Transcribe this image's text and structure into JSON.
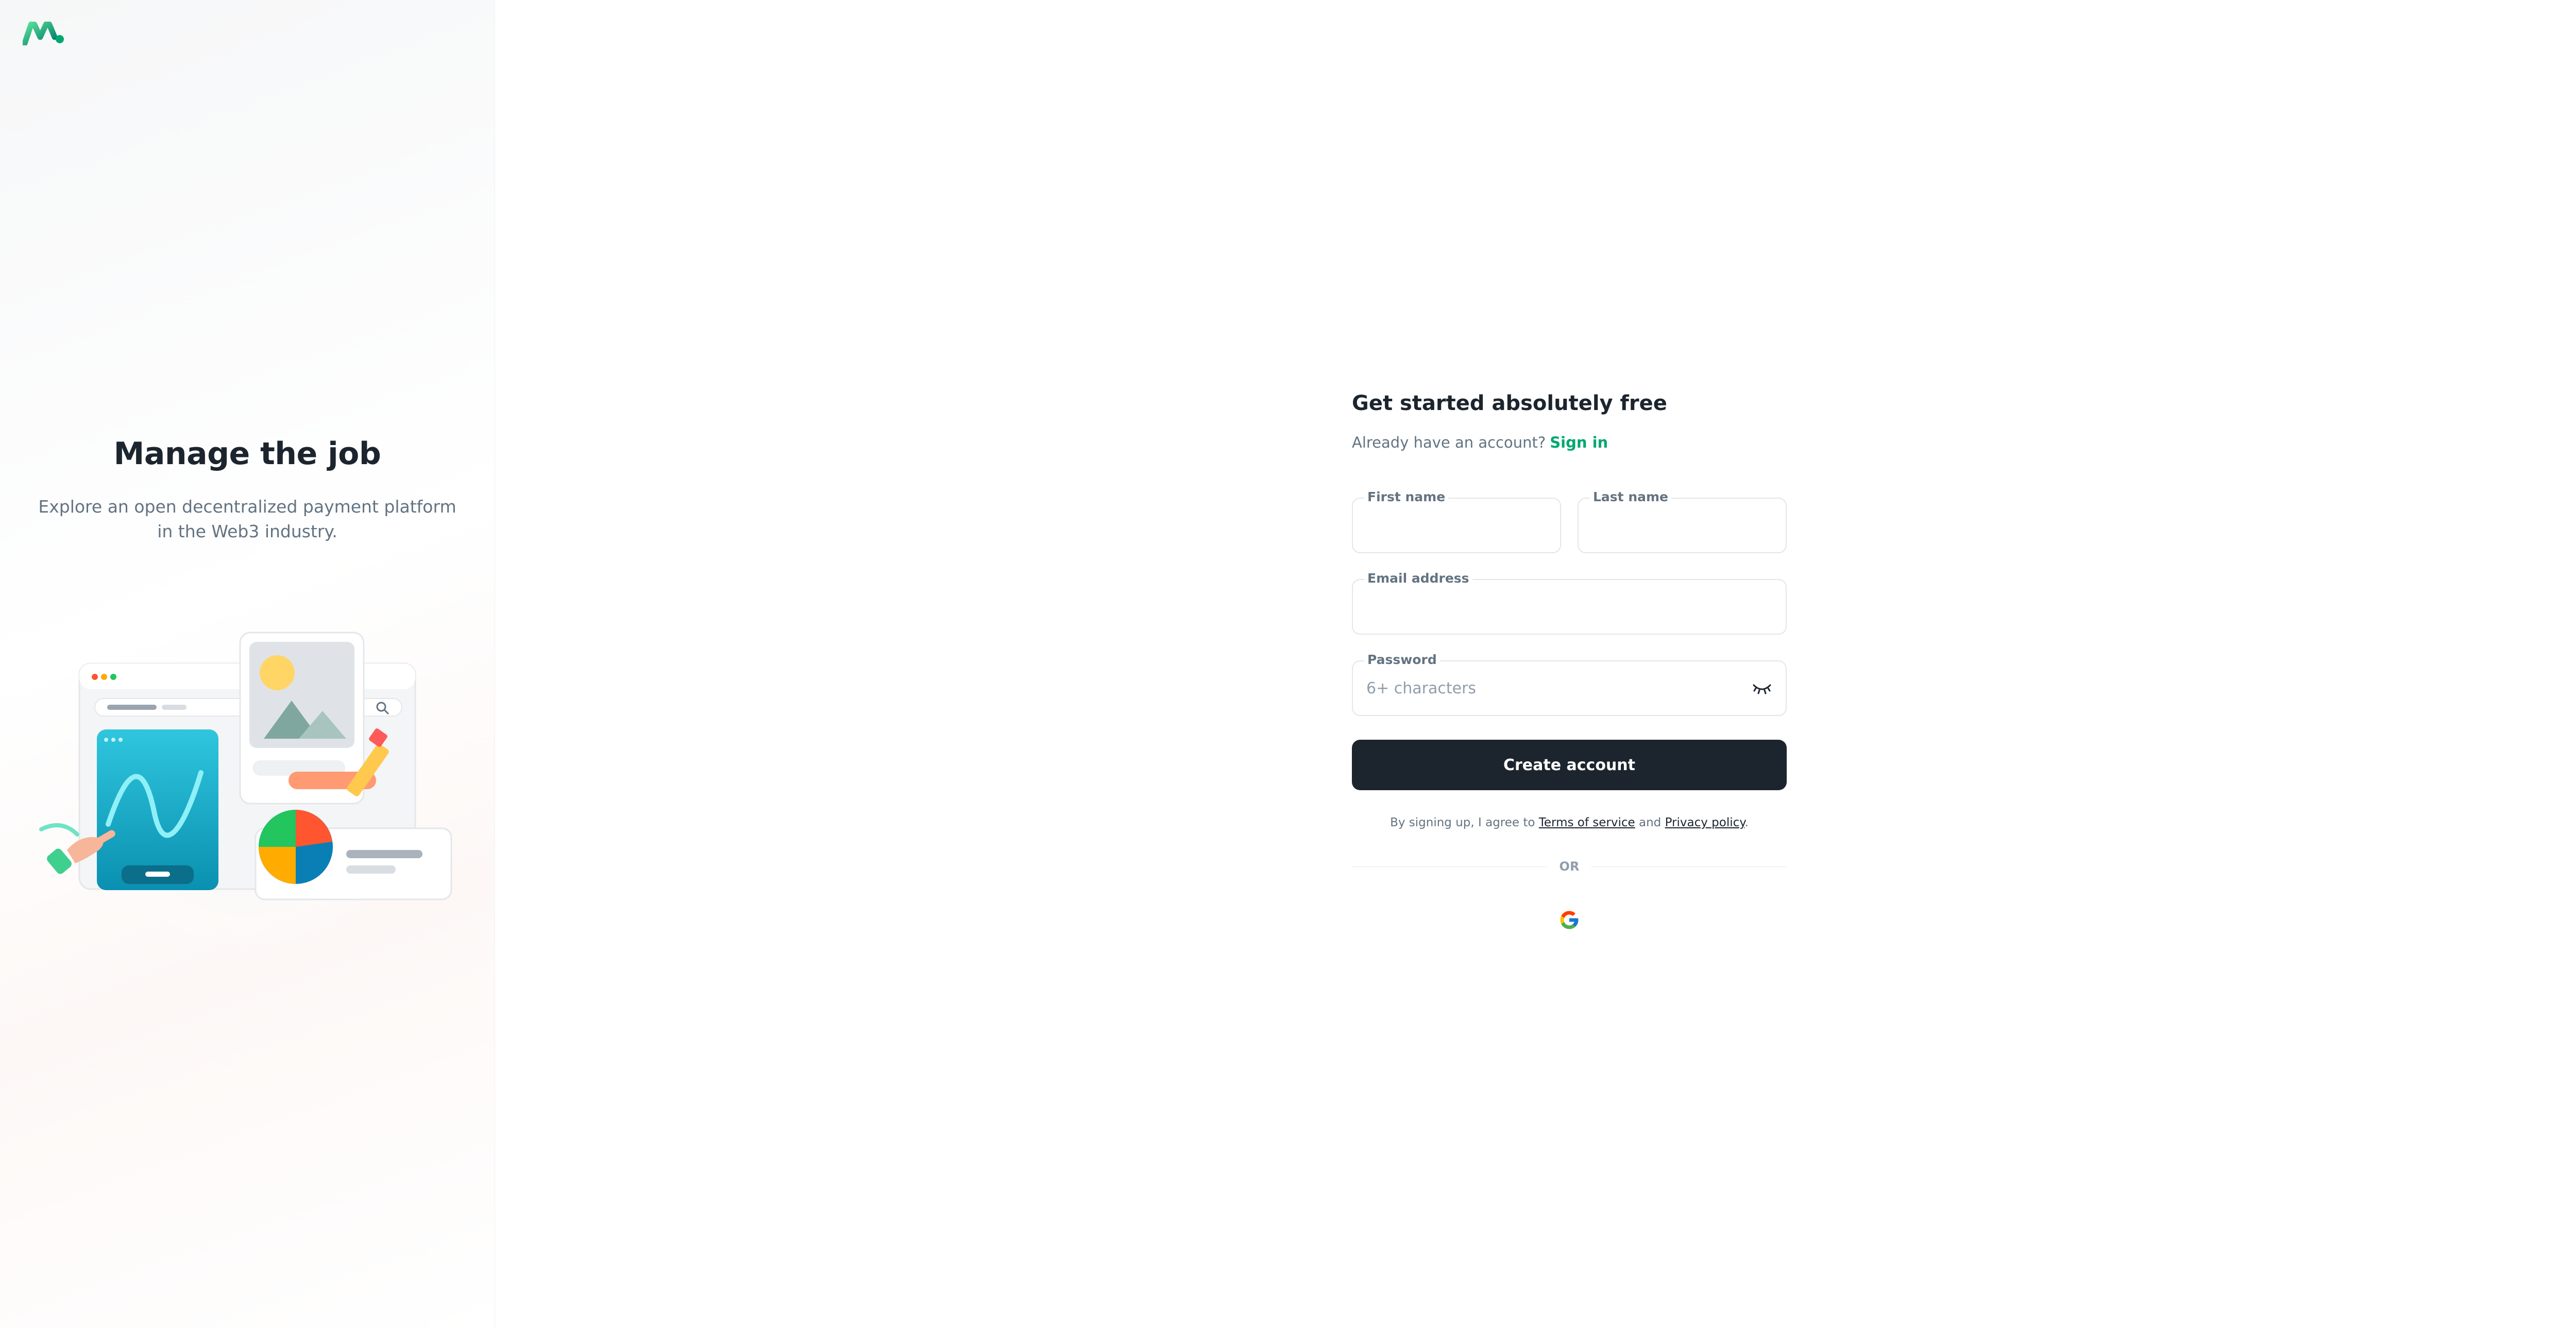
{
  "hero": {
    "title": "Manage the job",
    "subtitle": "Explore an open decentralized payment platform in the Web3 industry."
  },
  "form": {
    "title": "Get started absolutely free",
    "have_account_text": "Already have an account?",
    "signin_label": "Sign in",
    "first_name": {
      "label": "First name",
      "value": "",
      "placeholder": ""
    },
    "last_name": {
      "label": "Last name",
      "value": "",
      "placeholder": ""
    },
    "email": {
      "label": "Email address",
      "value": "",
      "placeholder": ""
    },
    "password": {
      "label": "Password",
      "value": "",
      "placeholder": "6+ characters"
    },
    "create_button": "Create account",
    "terms_prefix": "By signing up, I agree to",
    "terms_link": "Terms of service",
    "terms_and": "and",
    "privacy_link": "Privacy policy",
    "terms_suffix": ".",
    "divider_text": "OR"
  },
  "icons": {
    "logo": "brand-logo-icon",
    "settings": "gear-icon",
    "password_toggle": "eye-closed-icon",
    "google": "google-icon"
  },
  "colors": {
    "accent": "#00A76F",
    "primary_text": "#1C252E",
    "secondary_text": "#637381",
    "button_bg": "#1C252E"
  }
}
